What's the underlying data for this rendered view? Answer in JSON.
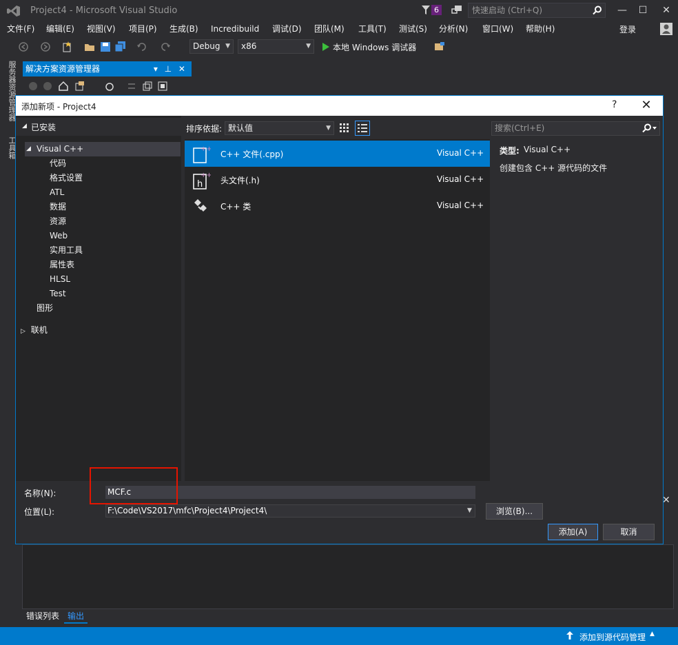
{
  "window": {
    "title": "Project4 - Microsoft Visual Studio",
    "notification_count": "6",
    "quick_launch_placeholder": "快速启动 (Ctrl+Q)",
    "minimize": "—",
    "maximize": "☐",
    "close": "✕"
  },
  "menu": {
    "items": [
      "文件(F)",
      "编辑(E)",
      "视图(V)",
      "项目(P)",
      "生成(B)",
      "Incredibuild",
      "调试(D)",
      "团队(M)",
      "工具(T)",
      "测试(S)",
      "分析(N)",
      "窗口(W)",
      "帮助(H)"
    ],
    "login": "登录"
  },
  "toolbar": {
    "config": "Debug",
    "platform": "x86",
    "run_label": "本地 Windows 调试器"
  },
  "left_strip": {
    "tab1": "服务器资源管理器",
    "tab2": "工具箱"
  },
  "solution_explorer": {
    "title": "解决方案资源管理器",
    "pin": "▾ ⊥ ✕"
  },
  "dialog": {
    "title": "添加新项 - Project4",
    "help": "?",
    "close": "✕",
    "tree": {
      "installed": "已安装",
      "visual_cpp": "Visual C++",
      "children": [
        "代码",
        "格式设置",
        "ATL",
        "数据",
        "资源",
        "Web",
        "实用工具",
        "属性表",
        "HLSL",
        "Test"
      ],
      "graphics": "图形",
      "online": "联机"
    },
    "sort_label": "排序依据:",
    "sort_value": "默认值",
    "search_placeholder": "搜索(Ctrl+E)",
    "templates": [
      {
        "name": "C++ 文件(.cpp)",
        "type": "Visual C++",
        "icon": "cpp-file-icon"
      },
      {
        "name": "头文件(.h)",
        "type": "Visual C++",
        "icon": "header-file-icon"
      },
      {
        "name": "C++ 类",
        "type": "Visual C++",
        "icon": "cpp-class-icon"
      }
    ],
    "info": {
      "type_key": "类型:",
      "type_value": "Visual C++",
      "description": "创建包含 C++ 源代码的文件"
    },
    "name_label": "名称(N):",
    "name_value": "MCF.c",
    "location_label": "位置(L):",
    "location_value": "F:\\Code\\VS2017\\mfc\\Project4\\Project4\\",
    "browse": "浏览(B)...",
    "add": "添加(A)",
    "cancel": "取消"
  },
  "bottom_tabs": [
    "错误列表",
    "输出"
  ],
  "status_bar": {
    "source_control": "添加到源代码管理"
  },
  "colors": {
    "accent": "#007acc",
    "background": "#2d2d30",
    "highlight_box": "#e51400"
  }
}
